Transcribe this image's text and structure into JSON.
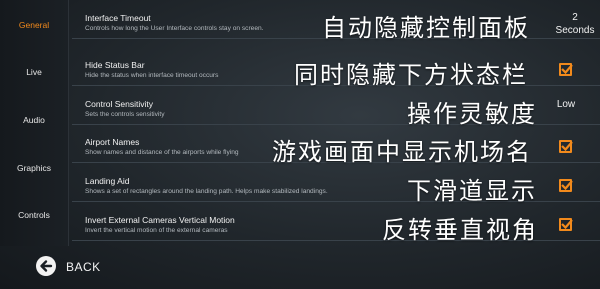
{
  "sidebar": {
    "tabs": [
      {
        "label": "General"
      },
      {
        "label": "Live"
      },
      {
        "label": "Audio"
      },
      {
        "label": "Graphics"
      },
      {
        "label": "Controls"
      }
    ]
  },
  "settings": [
    {
      "title": "Interface Timeout",
      "desc": "Controls how long the User Interface controls stay on screen.",
      "overlay": "自动隐藏控制面板",
      "value_number": "2",
      "value_unit": "Seconds"
    },
    {
      "title": "Hide Status Bar",
      "desc": "Hide the status when interface timeout occurs",
      "overlay": "同时隐藏下方状态栏",
      "checked": true
    },
    {
      "title": "Control Sensitivity",
      "desc": "Sets the controls sensitivity",
      "overlay": "操作灵敏度",
      "value": "Low"
    },
    {
      "title": "Airport Names",
      "desc": "Show names and distance of the airports while flying",
      "overlay": "游戏画面中显示机场名",
      "checked": true
    },
    {
      "title": "Landing Aid",
      "desc": "Shows a set of rectangles around the landing path. Helps make stabilized landings.",
      "overlay": "下滑道显示",
      "checked": true
    },
    {
      "title": "Invert External Cameras Vertical Motion",
      "desc": "Invert the vertical motion of the external cameras",
      "overlay": "反转垂直视角",
      "checked": true
    }
  ],
  "footer": {
    "back_label": "BACK",
    "back_icon": "back-arrow-icon"
  },
  "colors": {
    "accent": "#f28a1c",
    "background": "#252b31"
  }
}
